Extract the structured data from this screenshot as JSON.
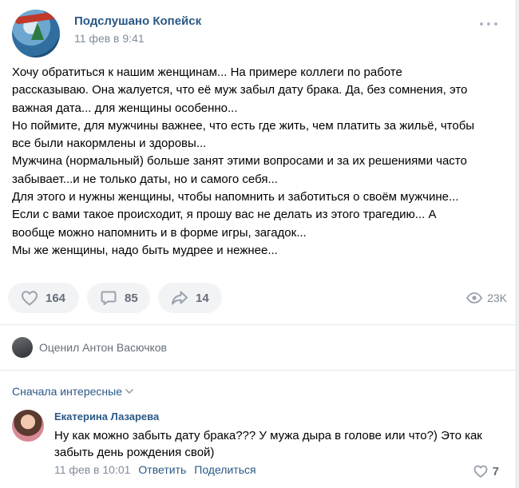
{
  "post": {
    "group_name": "Подслушано Копейск",
    "time": "11 фев в 9:41",
    "text_lines": [
      "Хочу обратиться к нашим женщинам... На примере коллеги по работе",
      "рассказываю. Она жалуется, что её муж забыл дату брака. Да, без сомнения, это",
      "важная дата... для женщины особенно...",
      "Но поймите, для мужчины важнее, что есть где жить, чем платить за жильё, чтобы",
      "все были накормлены и здоровы...",
      "Мужчина (нормальный) больше занят этими вопросами и за их решениями часто",
      "забывает...и не только даты, но и самого себя...",
      "Для этого и нужны женщины, чтобы напомнить и заботиться о своём мужчине...",
      "Если с вами такое происходит, я прошу вас не делать из этого трагедию... А",
      "вообще можно напомнить и в форме игры, загадок...",
      "Мы же женщины, надо быть мудрее и нежнее..."
    ],
    "likes": "164",
    "comments": "85",
    "shares": "14",
    "views": "23K"
  },
  "liked_by": "Оценил Антон Васючков",
  "sort_label": "Сначала интересные",
  "comment": {
    "author": "Екатерина Лазарева",
    "text": "Ну как можно забыть дату брака??? У мужа дыра в голове или что?) Это как забыть день рождения свой)",
    "time": "11 фев в 10:01",
    "reply": "Ответить",
    "share": "Поделиться",
    "likes": "7"
  },
  "colors": {
    "link": "#2a5885",
    "secondary": "#818c99",
    "icon": "#99a2ad",
    "pill_bg": "#f2f3f5"
  },
  "icons": [
    "more-icon",
    "heart-icon",
    "comment-icon",
    "share-icon",
    "eye-icon",
    "chevron-down-icon"
  ]
}
